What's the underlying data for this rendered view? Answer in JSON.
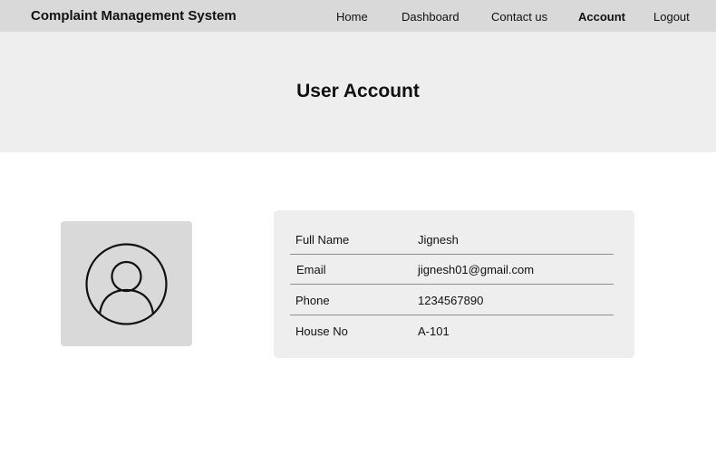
{
  "app": {
    "title": "Complaint Management System"
  },
  "nav": {
    "items": [
      {
        "label": "Home"
      },
      {
        "label": "Dashboard"
      },
      {
        "label": "Contact us"
      },
      {
        "label": "Account"
      },
      {
        "label": "Logout"
      }
    ],
    "active": "Account"
  },
  "hero": {
    "title": "User Account"
  },
  "avatar": {
    "icon": "user-circle-icon"
  },
  "profile": {
    "rows": [
      {
        "label": "Full Name",
        "value": "Jignesh"
      },
      {
        "label": "Email",
        "value": "jignesh01@gmail.com"
      },
      {
        "label": "Phone",
        "value": "1234567890"
      },
      {
        "label": "House No",
        "value": "A-101"
      }
    ]
  },
  "colors": {
    "navbar_bg": "#d9d9d9",
    "hero_bg": "#eeeeee",
    "card_bg": "#eeeeee",
    "avatar_bg": "#d9d9d9",
    "divider": "#8f8f8f"
  }
}
